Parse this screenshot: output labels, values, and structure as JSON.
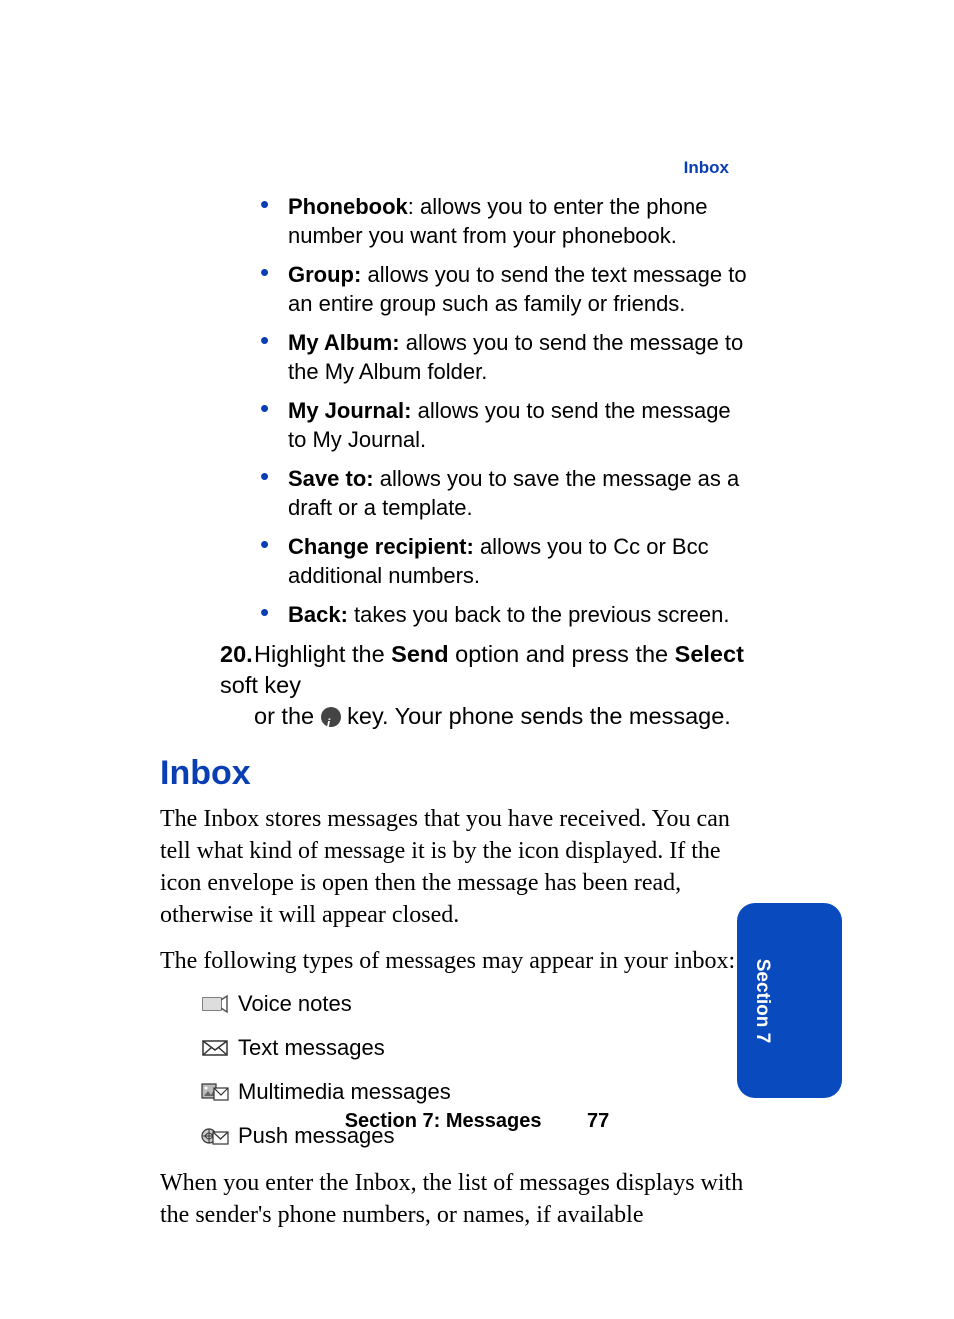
{
  "header": {
    "running_head": "Inbox"
  },
  "bullets": [
    {
      "term": "Phonebook",
      "sep": ": ",
      "desc": "allows you to enter the phone number you want from your phonebook."
    },
    {
      "term": "Group:",
      "sep": " ",
      "desc": "allows you to send the text message to an entire group such as family or friends."
    },
    {
      "term": "My Album:",
      "sep": " ",
      "desc": "allows you to send the message to the My Album folder."
    },
    {
      "term": "My Journal:",
      "sep": " ",
      "desc": "allows you to send the message to My Journal."
    },
    {
      "term": "Save to:",
      "sep": " ",
      "desc": "allows you to save the message as a draft or a template."
    },
    {
      "term": "Change recipient:",
      "sep": " ",
      "desc": "allows you to Cc or Bcc additional numbers."
    },
    {
      "term": "Back:",
      "sep": " ",
      "desc": "takes you back to the previous screen."
    }
  ],
  "step": {
    "num": "20.",
    "pre": "Highlight the ",
    "b1": "Send",
    "mid": " option and press the ",
    "b2": "Select",
    "post1": " soft key",
    "line2a": "or the ",
    "line2b": " key. Your phone sends the message."
  },
  "heading": "Inbox",
  "para1": "The Inbox stores messages that you have received. You can tell what kind of message it is by the icon displayed. If the icon envelope is open then the message has been read, otherwise it will appear closed.",
  "para2": "The following types of messages may appear in your inbox:",
  "msg_types": [
    {
      "label": "Voice notes"
    },
    {
      "label": "Text messages"
    },
    {
      "label": "Multimedia messages"
    },
    {
      "label": "Push messages"
    }
  ],
  "para3": "When you enter the Inbox, the list of messages displays with the sender's phone numbers, or names, if available",
  "footer": {
    "section": "Section 7: Messages",
    "page": "77"
  },
  "side_tab": "Section 7"
}
